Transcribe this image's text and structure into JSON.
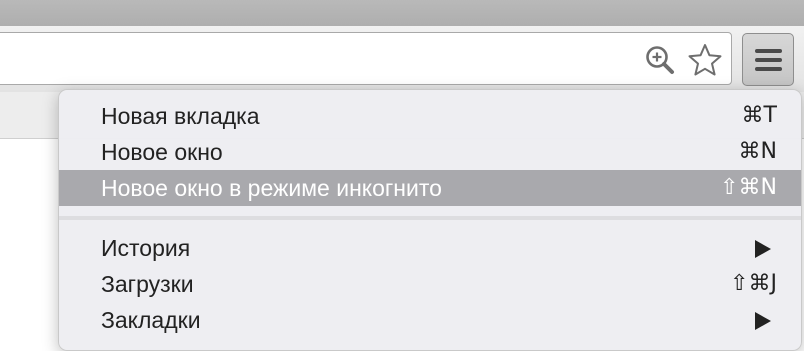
{
  "menu": {
    "items": [
      {
        "label": "Новая вкладка",
        "shortcut": "⌘T"
      },
      {
        "label": "Новое окно",
        "shortcut": "⌘N"
      },
      {
        "label": "Новое окно в режиме инкогнито",
        "shortcut": "⇧⌘N",
        "highlighted": true
      },
      {
        "label": "История",
        "submenu": true
      },
      {
        "label": "Загрузки",
        "shortcut": "⇧⌘J"
      },
      {
        "label": "Закладки",
        "submenu": true
      }
    ]
  },
  "icons": {
    "zoom": "zoom-in-icon",
    "bookmark": "star-icon",
    "menu": "hamburger-icon"
  },
  "colors": {
    "highlight": "#a9a9ad",
    "menu_background": "#eeeef2",
    "toolbar": "#e8e8e8"
  }
}
